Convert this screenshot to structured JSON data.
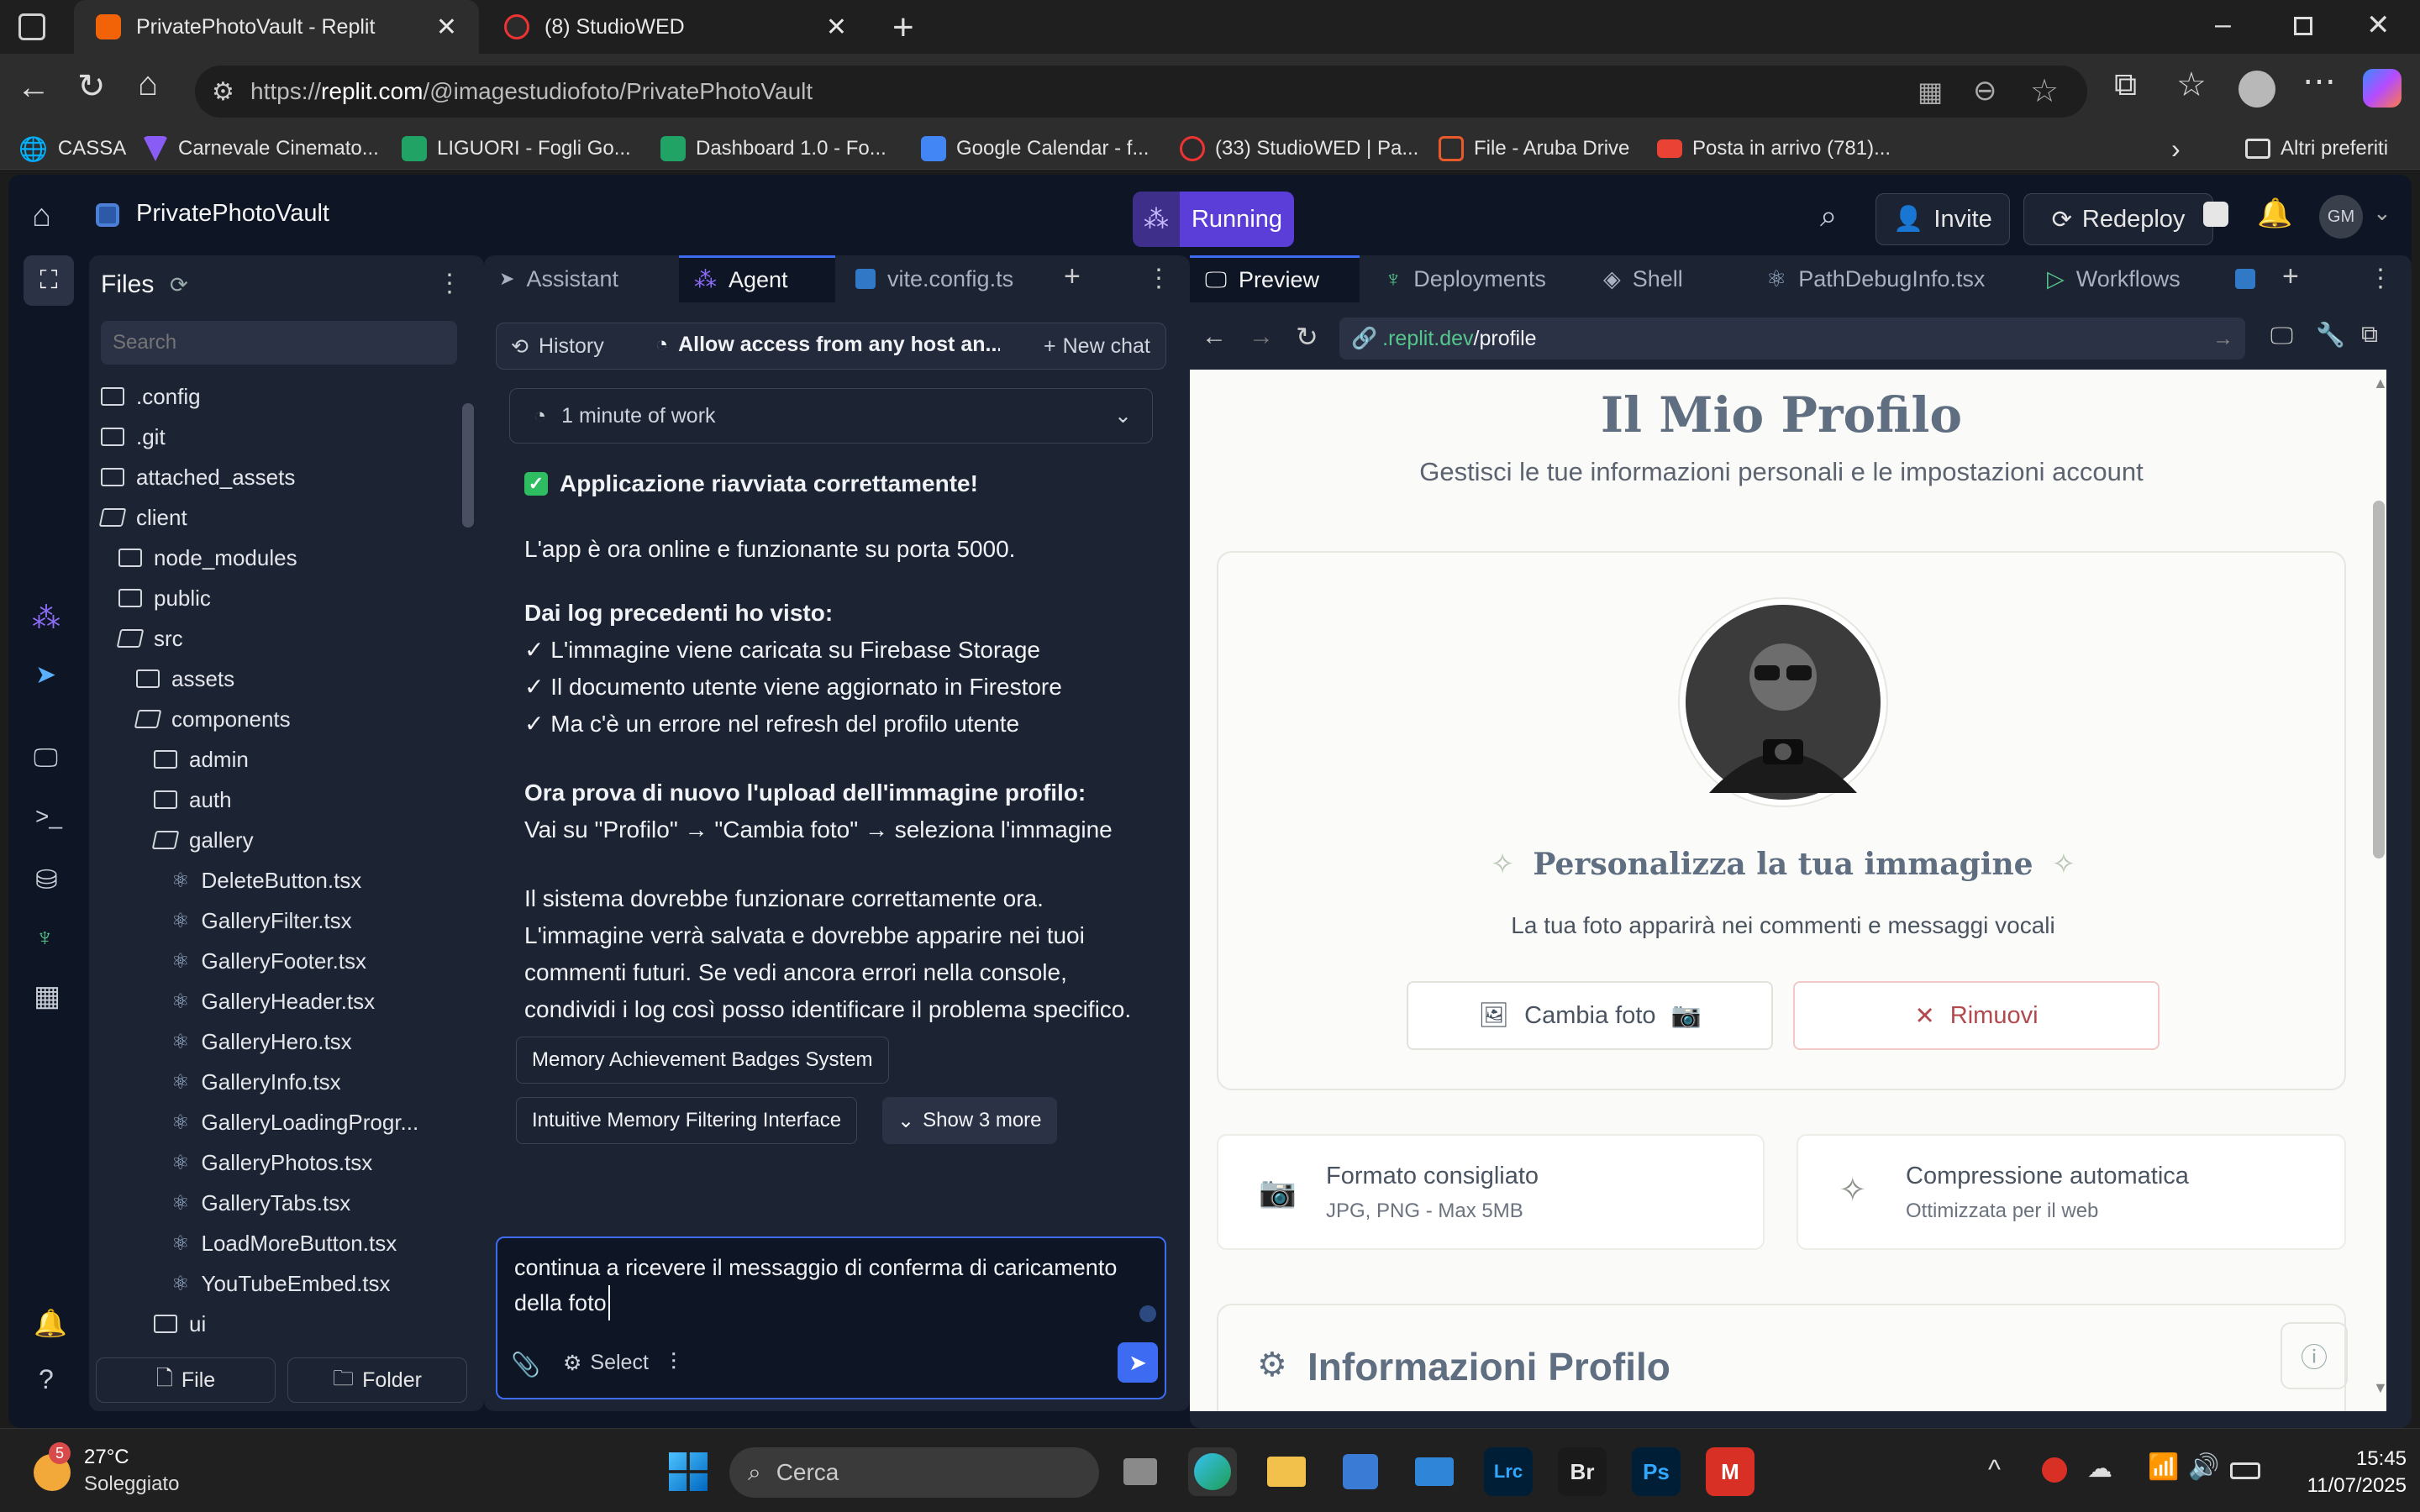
{
  "browser": {
    "tabs": [
      {
        "title": "PrivatePhotoVault - Replit",
        "active": true
      },
      {
        "title": "(8) StudioWED",
        "active": false
      }
    ],
    "url_prefix": "https://",
    "url_host": "replit.com",
    "url_path": "/@imagestudiofoto/PrivatePhotoVault",
    "bookmarks": [
      "CASSA",
      "Carnevale Cinemato...",
      "LIGUORI - Fogli Go...",
      "Dashboard 1.0 - Fo...",
      "Google Calendar - f...",
      "(33) StudioWED | Pa...",
      "File - Aruba Drive",
      "Posta in arrivo (781)..."
    ],
    "other_bookmarks": "Altri preferiti"
  },
  "app": {
    "project_name": "PrivatePhotoVault",
    "run_status": "Running",
    "invite": "Invite",
    "redeploy": "Redeploy",
    "avatar_initials": "GM"
  },
  "files": {
    "title": "Files",
    "search_placeholder": "Search",
    "items": [
      {
        "name": ".config",
        "type": "folder",
        "depth": 0
      },
      {
        "name": ".git",
        "type": "folder",
        "depth": 0
      },
      {
        "name": "attached_assets",
        "type": "folder",
        "depth": 0
      },
      {
        "name": "client",
        "type": "folder-open",
        "depth": 0
      },
      {
        "name": "node_modules",
        "type": "folder",
        "depth": 1
      },
      {
        "name": "public",
        "type": "folder",
        "depth": 1
      },
      {
        "name": "src",
        "type": "folder-open",
        "depth": 1
      },
      {
        "name": "assets",
        "type": "folder",
        "depth": 2
      },
      {
        "name": "components",
        "type": "folder-open",
        "depth": 2
      },
      {
        "name": "admin",
        "type": "folder",
        "depth": 3
      },
      {
        "name": "auth",
        "type": "folder",
        "depth": 3
      },
      {
        "name": "gallery",
        "type": "folder-open",
        "depth": 3
      },
      {
        "name": "DeleteButton.tsx",
        "type": "react",
        "depth": 4
      },
      {
        "name": "GalleryFilter.tsx",
        "type": "react",
        "depth": 4
      },
      {
        "name": "GalleryFooter.tsx",
        "type": "react",
        "depth": 4
      },
      {
        "name": "GalleryHeader.tsx",
        "type": "react",
        "depth": 4
      },
      {
        "name": "GalleryHero.tsx",
        "type": "react",
        "depth": 4
      },
      {
        "name": "GalleryInfo.tsx",
        "type": "react",
        "depth": 4
      },
      {
        "name": "GalleryLoadingProgr...",
        "type": "react",
        "depth": 4
      },
      {
        "name": "GalleryPhotos.tsx",
        "type": "react",
        "depth": 4
      },
      {
        "name": "GalleryTabs.tsx",
        "type": "react",
        "depth": 4
      },
      {
        "name": "LoadMoreButton.tsx",
        "type": "react",
        "depth": 4
      },
      {
        "name": "YouTubeEmbed.tsx",
        "type": "react",
        "depth": 4
      },
      {
        "name": "ui",
        "type": "folder",
        "depth": 3
      }
    ],
    "new_file": "File",
    "new_folder": "Folder"
  },
  "agent": {
    "tabs": [
      "Assistant",
      "Agent",
      "vite.config.ts"
    ],
    "history": "History",
    "chat_title": "Allow access from any host an...",
    "new_chat": "New chat",
    "work_summary": "1 minute of work",
    "heading": "Applicazione riavviata correttamente!",
    "p1": "L'app è ora online e funzionante su porta 5000.",
    "logs_title": "Dai log precedenti ho visto:",
    "logs": [
      "✓ L'immagine viene caricata su Firebase Storage",
      "✓ Il documento utente viene aggiornato in Firestore",
      "✓ Ma c'è un errore nel refresh del profilo utente"
    ],
    "retry_title": "Ora prova di nuovo l'upload dell'immagine profilo:",
    "retry_steps": "Vai su \"Profilo\" → \"Cambia foto\" → seleziona l'immagine",
    "closing": [
      "Il sistema dovrebbe funzionare correttamente ora.",
      "L'immagine verrà salvata e dovrebbe apparire nei tuoi",
      "commenti futuri. Se vedi ancora errori nella console,",
      "condividi i log così posso identificare il problema specifico."
    ],
    "suggestions": [
      "Memory Achievement Badges System",
      "Intuitive Memory Filtering Interface"
    ],
    "show_more": "Show 3 more",
    "input_lines": [
      "continua a ricevere il messaggio di conferma di caricamento",
      "della foto"
    ],
    "select": "Select"
  },
  "preview": {
    "tabs": [
      "Preview",
      "Deployments",
      "Shell",
      "PathDebugInfo.tsx",
      "Workflows"
    ],
    "url_host": ".replit.dev",
    "url_path": "/profile",
    "page_title": "Il Mio Profilo",
    "page_subtitle": "Gestisci le tue informazioni personali e le impostazioni account",
    "customize_title": "Personalizza la tua immagine",
    "customize_sub": "La tua foto apparirà nei commenti e messaggi vocali",
    "change_photo": "Cambia foto",
    "remove": "Rimuovi",
    "format_title": "Formato consigliato",
    "format_sub": "JPG, PNG - Max 5MB",
    "compress_title": "Compressione automatica",
    "compress_sub": "Ottimizzata per il web",
    "info_title": "Informazioni Profilo",
    "accent_color": "#1e3a5f",
    "remove_color": "#c0454a"
  },
  "taskbar": {
    "weather_temp": "27°C",
    "weather_desc": "Soleggiato",
    "weather_badge": "5",
    "search": "Cerca",
    "apps": [
      "Lrc",
      "Br",
      "Ps"
    ],
    "time": "15:45",
    "date": "11/07/2025"
  }
}
